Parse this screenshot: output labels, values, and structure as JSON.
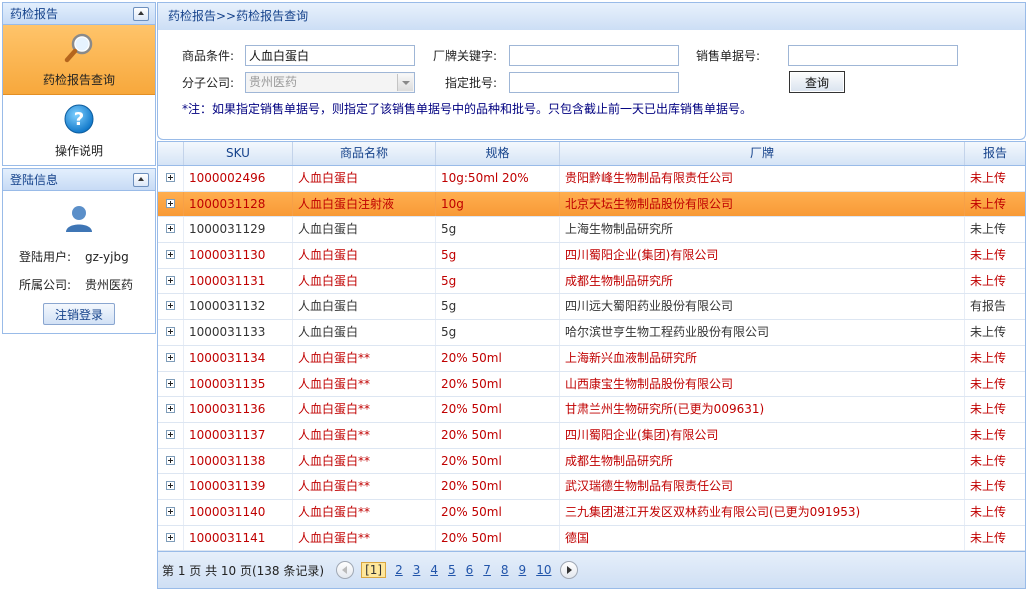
{
  "sidebar": {
    "report_panel": {
      "title": "药检报告",
      "items": [
        {
          "label": "药检报告查询",
          "icon": "magnifier-icon",
          "active": true
        },
        {
          "label": "操作说明",
          "icon": "help-icon",
          "active": false
        }
      ]
    },
    "login_panel": {
      "title": "登陆信息",
      "user_label": "登陆用户:",
      "user_value": "gz-yjbg",
      "company_label": "所属公司:",
      "company_value": "贵州医药",
      "logout_label": "注销登录"
    }
  },
  "main": {
    "breadcrumb": "药检报告>>药检报告查询",
    "form": {
      "product_label": "商品条件:",
      "product_value": "人血白蛋白",
      "vendor_label": "厂牌关键字:",
      "vendor_value": "",
      "sales_no_label": "销售单据号:",
      "sales_no_value": "",
      "branch_label": "分子公司:",
      "branch_value": "贵州医药",
      "batch_label": "指定批号:",
      "batch_value": "",
      "query_label": "查询",
      "note": "*注：如果指定销售单据号，则指定了该销售单据号中的品种和批号。只包含截止前一天已出库销售单据号。"
    },
    "grid": {
      "columns": [
        "SKU",
        "商品名称",
        "规格",
        "厂牌",
        "报告"
      ],
      "rows": [
        {
          "sku": "1000002496",
          "name": "人血白蛋白",
          "spec": "10g:50ml 20%",
          "brand": "贵阳黔峰生物制品有限责任公司",
          "report": "未上传",
          "style": "red"
        },
        {
          "sku": "1000031128",
          "name": "人血白蛋白注射液",
          "spec": "10g",
          "brand": "北京天坛生物制品股份有限公司",
          "report": "未上传",
          "style": "selected"
        },
        {
          "sku": "1000031129",
          "name": "人血白蛋白",
          "spec": "5g",
          "brand": "上海生物制品研究所",
          "report": "未上传",
          "style": "gray"
        },
        {
          "sku": "1000031130",
          "name": "人血白蛋白",
          "spec": "5g",
          "brand": "四川蜀阳企业(集团)有限公司",
          "report": "未上传",
          "style": "red"
        },
        {
          "sku": "1000031131",
          "name": "人血白蛋白",
          "spec": "5g",
          "brand": "成都生物制品研究所",
          "report": "未上传",
          "style": "red"
        },
        {
          "sku": "1000031132",
          "name": "人血白蛋白",
          "spec": "5g",
          "brand": "四川远大蜀阳药业股份有限公司",
          "report": "有报告",
          "style": "gray"
        },
        {
          "sku": "1000031133",
          "name": "人血白蛋白",
          "spec": "5g",
          "brand": "哈尔滨世亨生物工程药业股份有限公司",
          "report": "未上传",
          "style": "gray"
        },
        {
          "sku": "1000031134",
          "name": "人血白蛋白**",
          "spec": "20% 50ml",
          "brand": "上海新兴血液制品研究所",
          "report": "未上传",
          "style": "red"
        },
        {
          "sku": "1000031135",
          "name": "人血白蛋白**",
          "spec": "20% 50ml",
          "brand": "山西康宝生物制品股份有限公司",
          "report": "未上传",
          "style": "red"
        },
        {
          "sku": "1000031136",
          "name": "人血白蛋白**",
          "spec": "20% 50ml",
          "brand": "甘肃兰州生物研究所(已更为009631)",
          "report": "未上传",
          "style": "red"
        },
        {
          "sku": "1000031137",
          "name": "人血白蛋白**",
          "spec": "20% 50ml",
          "brand": "四川蜀阳企业(集团)有限公司",
          "report": "未上传",
          "style": "red"
        },
        {
          "sku": "1000031138",
          "name": "人血白蛋白**",
          "spec": "20% 50ml",
          "brand": "成都生物制品研究所",
          "report": "未上传",
          "style": "red"
        },
        {
          "sku": "1000031139",
          "name": "人血白蛋白**",
          "spec": "20% 50ml",
          "brand": "武汉瑞德生物制品有限责任公司",
          "report": "未上传",
          "style": "red"
        },
        {
          "sku": "1000031140",
          "name": "人血白蛋白**",
          "spec": "20% 50ml",
          "brand": "三九集团湛江开发区双林药业有限公司(已更为091953)",
          "report": "未上传",
          "style": "red"
        },
        {
          "sku": "1000031141",
          "name": "人血白蛋白**",
          "spec": "20% 50ml",
          "brand": "德国",
          "report": "未上传",
          "style": "red"
        }
      ]
    },
    "pager": {
      "info": "第 1 页 共 10 页(138 条记录)",
      "current": "[1]",
      "pages": [
        "2",
        "3",
        "4",
        "5",
        "6",
        "7",
        "8",
        "9",
        "10"
      ]
    }
  }
}
